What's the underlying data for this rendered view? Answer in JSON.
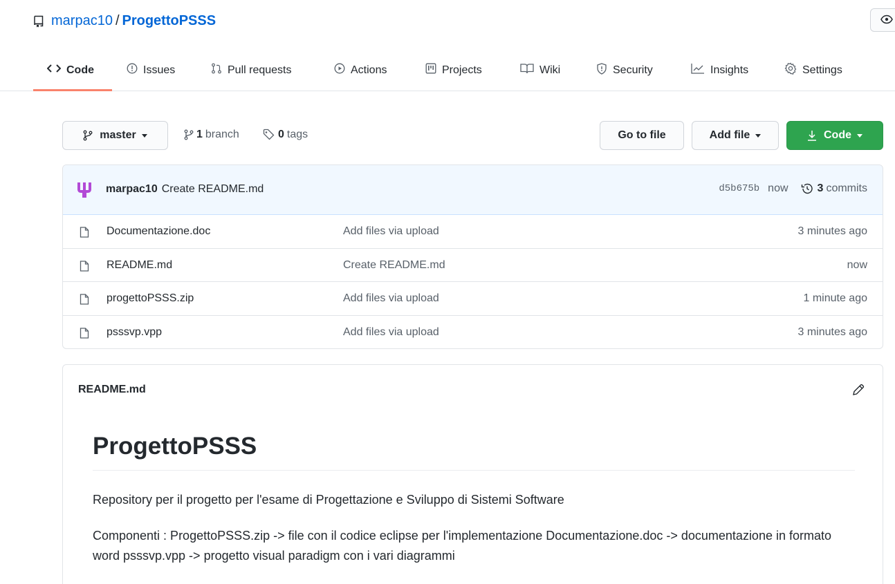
{
  "repo": {
    "owner": "marpac10",
    "separator": "/",
    "name": "ProgettoPSSS"
  },
  "tabs": [
    {
      "label": "Code",
      "icon": "code-icon",
      "selected": true
    },
    {
      "label": "Issues",
      "icon": "issue-icon"
    },
    {
      "label": "Pull requests",
      "icon": "pull-request-icon"
    },
    {
      "label": "Actions",
      "icon": "play-icon"
    },
    {
      "label": "Projects",
      "icon": "project-icon"
    },
    {
      "label": "Wiki",
      "icon": "book-icon"
    },
    {
      "label": "Security",
      "icon": "shield-icon"
    },
    {
      "label": "Insights",
      "icon": "graph-icon"
    },
    {
      "label": "Settings",
      "icon": "gear-icon"
    }
  ],
  "toolbar": {
    "branch": "master",
    "branches_count": "1",
    "branches_label": "branch",
    "tags_count": "0",
    "tags_label": "tags",
    "go_to_file": "Go to file",
    "add_file": "Add file",
    "code": "Code"
  },
  "commit": {
    "author": "marpac10",
    "message": "Create README.md",
    "sha": "d5b675b",
    "time": "now",
    "count": "3",
    "count_label": "commits"
  },
  "files": [
    {
      "name": "Documentazione.doc",
      "message": "Add files via upload",
      "age": "3 minutes ago"
    },
    {
      "name": "README.md",
      "message": "Create README.md",
      "age": "now"
    },
    {
      "name": "progettoPSSS.zip",
      "message": "Add files via upload",
      "age": "1 minute ago"
    },
    {
      "name": "psssvp.vpp",
      "message": "Add files via upload",
      "age": "3 minutes ago"
    }
  ],
  "readme": {
    "filename": "README.md",
    "title": "ProgettoPSSS",
    "paragraph1": "Repository per il progetto per l'esame di Progettazione e Sviluppo di Sistemi Software",
    "paragraph2": "Componenti : ProgettoPSSS.zip -> file con il codice eclipse per l'implementazione Documentazione.doc -> documentazione in formato word psssvp.vpp -> progetto visual paradigm con i vari diagrammi"
  },
  "colors": {
    "link": "#0366d6",
    "tab_underline": "#f9826c",
    "green_button": "#2ea44f",
    "commit_bar": "#f1f8ff",
    "avatar": "#b24ad6"
  }
}
